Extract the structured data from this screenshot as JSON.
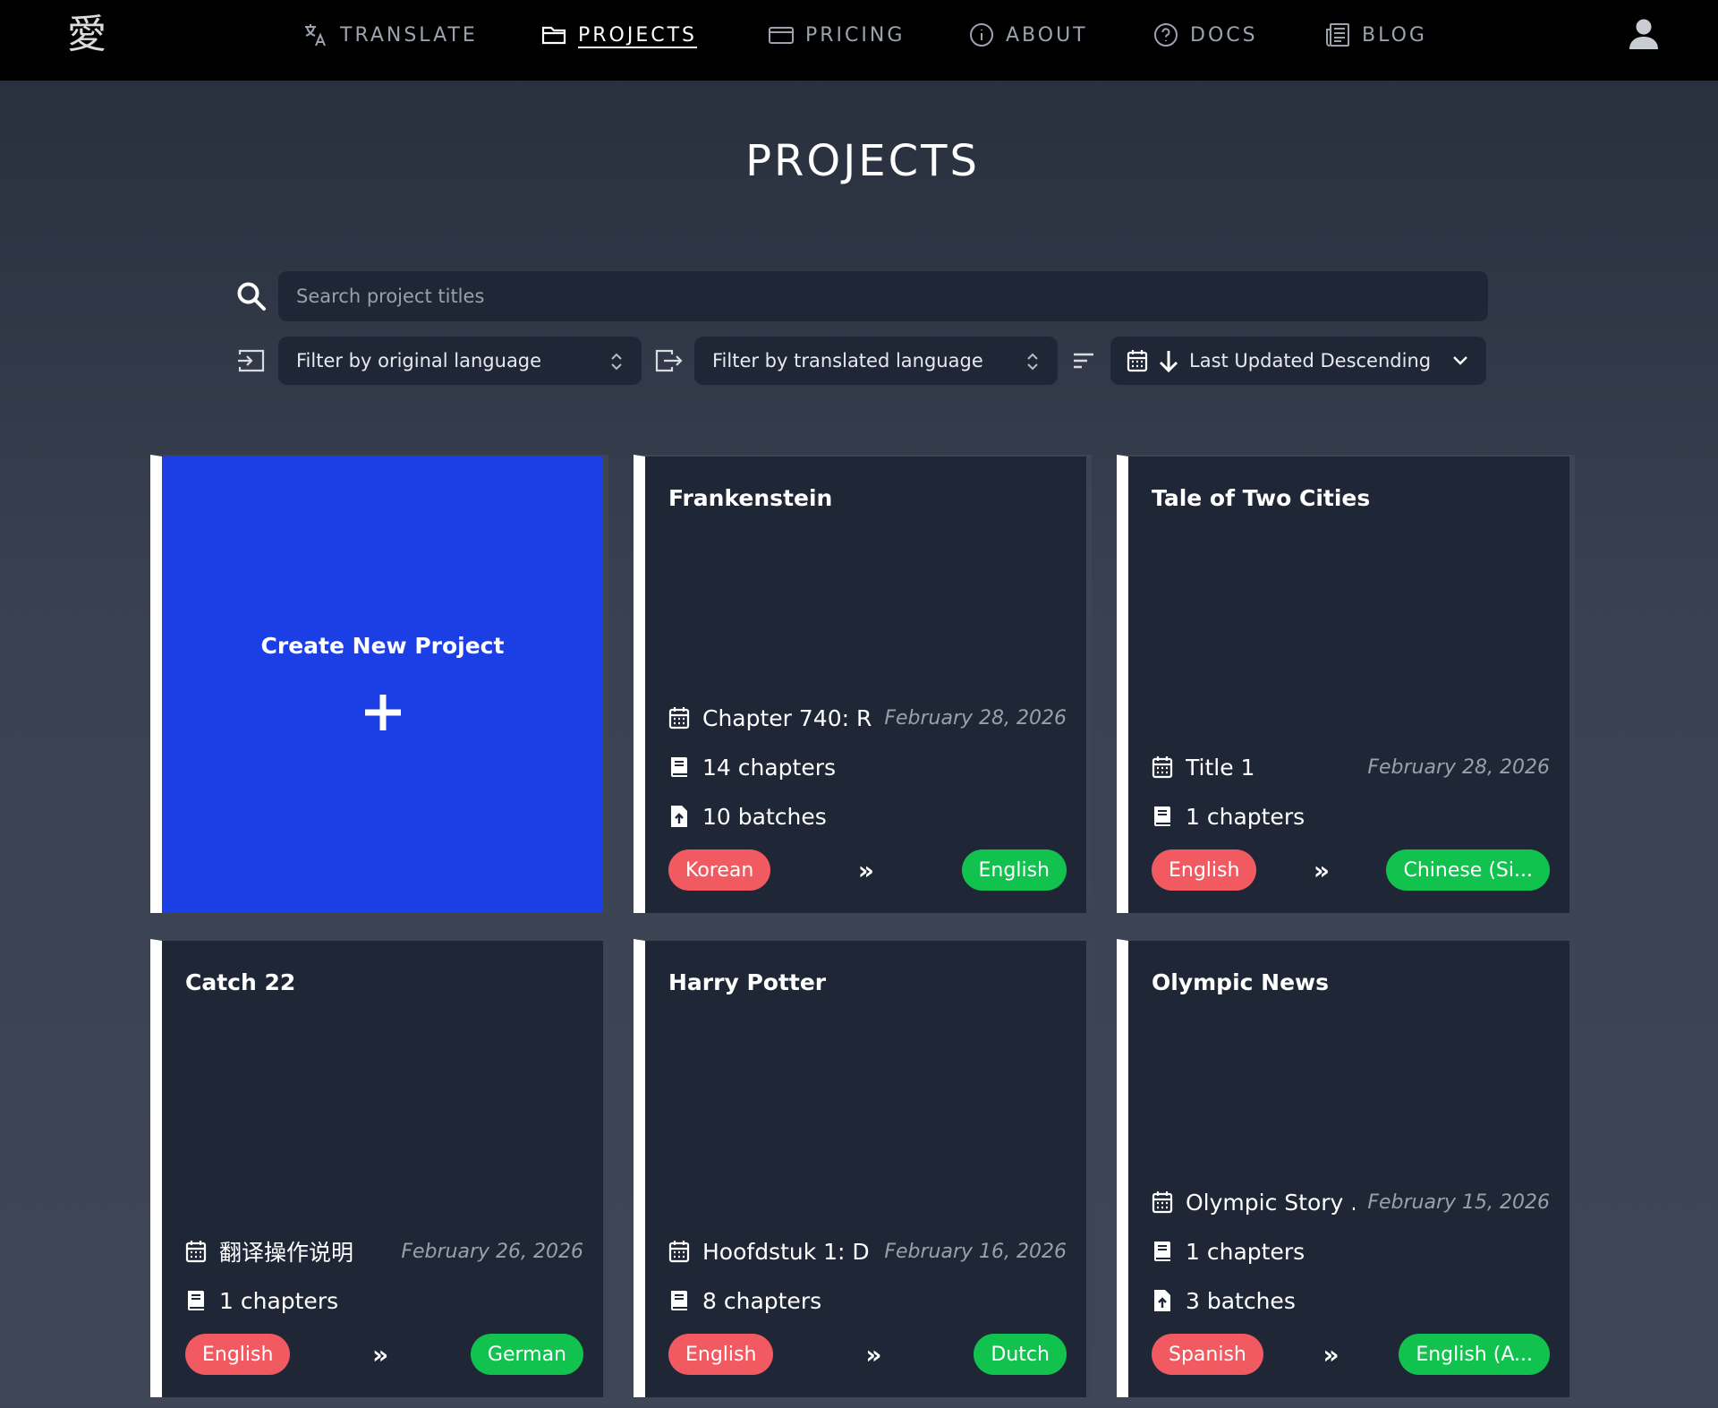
{
  "nav": {
    "logo": "愛",
    "items": [
      {
        "label": "TRANSLATE"
      },
      {
        "label": "PROJECTS"
      },
      {
        "label": "PRICING"
      },
      {
        "label": "ABOUT"
      },
      {
        "label": "DOCS"
      },
      {
        "label": "BLOG"
      }
    ],
    "active": "PROJECTS"
  },
  "page": {
    "title": "PROJECTS"
  },
  "search": {
    "placeholder": "Search project titles",
    "value": ""
  },
  "filters": {
    "original_language": "Filter by original language",
    "translated_language": "Filter by translated language",
    "sort": "Last Updated Descending"
  },
  "create_card": {
    "label": "Create New Project"
  },
  "projects": [
    {
      "title": "Frankenstein",
      "latest": "Chapter 740: R...",
      "date": "February 28, 2026",
      "chapters": "14 chapters",
      "batches": "10 batches",
      "original": "Korean",
      "translated": "English"
    },
    {
      "title": "Tale of Two Cities",
      "latest": "Title 1",
      "date": "February 28, 2026",
      "chapters": "1 chapters",
      "original": "English",
      "translated": "Chinese (Si..."
    },
    {
      "title": "Catch 22",
      "latest": "翻译操作说明",
      "date": "February 26, 2026",
      "chapters": "1 chapters",
      "original": "English",
      "translated": "German"
    },
    {
      "title": "Harry Potter",
      "latest": "Hoofdstuk 1: D...",
      "date": "February 16, 2026",
      "chapters": "8 chapters",
      "original": "English",
      "translated": "Dutch"
    },
    {
      "title": "Olympic News",
      "latest": "Olympic Story ...",
      "date": "February 15, 2026",
      "chapters": "1 chapters",
      "batches": "3 batches",
      "original": "Spanish",
      "translated": "English (A..."
    }
  ],
  "separator": "»",
  "colors": {
    "original_pill": "#f05a60",
    "translated_pill": "#12c24e",
    "create_card": "#1c3fe5",
    "card_bg": "#1f2737"
  }
}
